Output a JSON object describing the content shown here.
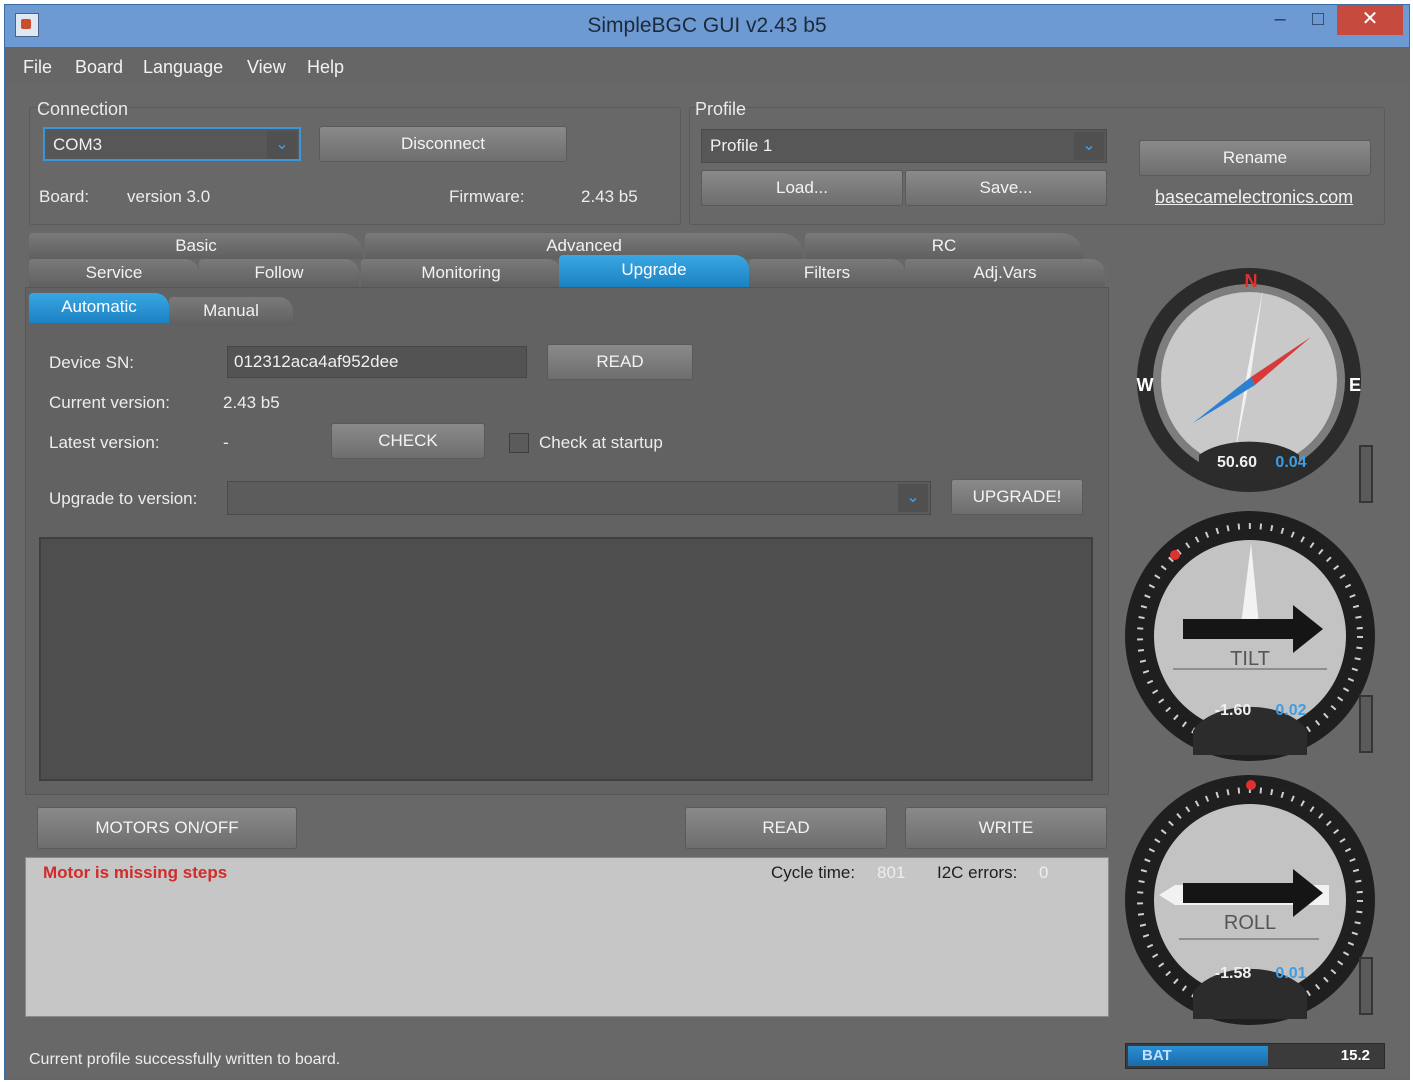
{
  "window": {
    "title": "SimpleBGC GUI v2.43 b5",
    "minimize": "–",
    "maximize": "□",
    "close": "✕"
  },
  "menu": [
    "File",
    "Board",
    "Language",
    "View",
    "Help"
  ],
  "connection": {
    "label": "Connection",
    "port": "COM3",
    "disconnect_label": "Disconnect",
    "board_label": "Board:",
    "board_value": "version 3.0",
    "firmware_label": "Firmware:",
    "firmware_value": "2.43 b5"
  },
  "profile": {
    "label": "Profile",
    "selected": "Profile 1",
    "load_label": "Load...",
    "save_label": "Save...",
    "rename_label": "Rename",
    "link": "basecamelectronics.com"
  },
  "tabs": {
    "groups": [
      "Basic",
      "Advanced",
      "RC"
    ],
    "items": [
      "Service",
      "Follow",
      "Monitoring",
      "Upgrade",
      "Filters",
      "Adj.Vars"
    ],
    "active": "Upgrade",
    "subtabs": [
      "Automatic",
      "Manual"
    ],
    "active_subtab": "Automatic"
  },
  "upgrade": {
    "device_sn_label": "Device SN:",
    "device_sn_value": "012312aca4af952dee",
    "read_label": "READ",
    "current_version_label": "Current version:",
    "current_version_value": "2.43 b5",
    "latest_version_label": "Latest version:",
    "latest_version_value": "-",
    "check_label": "CHECK",
    "check_at_startup_label": "Check at startup",
    "check_at_startup": false,
    "upgrade_to_label": "Upgrade to version:",
    "upgrade_to_value": "",
    "upgrade_label": "UPGRADE!"
  },
  "bottom": {
    "motors_label": "MOTORS ON/OFF",
    "read_label": "READ",
    "write_label": "WRITE",
    "error_text": "Motor is missing steps",
    "cycle_time_label": "Cycle time:",
    "cycle_time_value": "801",
    "i2c_label": "I2C errors:",
    "i2c_value": "0",
    "status_message": "Current profile successfully written to board."
  },
  "gauges": {
    "compass": {
      "n": "N",
      "e": "E",
      "w": "W",
      "value": "50.60",
      "rate": "0.04"
    },
    "tilt": {
      "label": "TILT",
      "value": "-1.60",
      "rate": "0.02"
    },
    "roll": {
      "label": "ROLL",
      "value": "-1.58",
      "rate": "0.01"
    }
  },
  "battery": {
    "label": "BAT",
    "value": "15.2",
    "level": 0.55
  },
  "colors": {
    "accent": "#2a92d4",
    "error": "#d42a2a",
    "background": "#686868"
  }
}
